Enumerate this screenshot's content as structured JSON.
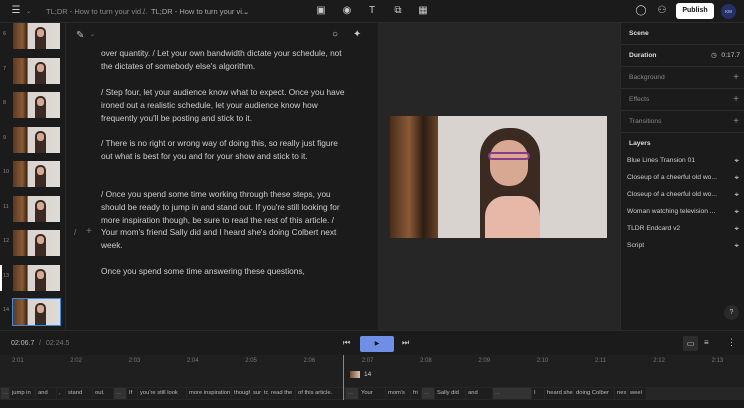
{
  "topbar": {
    "crumb1": "TL;DR - How to turn your vid...",
    "sep": "/",
    "crumb2": "TL;DR - How to turn your vi...",
    "publish": "Publish",
    "avatar": "KM"
  },
  "scenes": [
    {
      "n": "6"
    },
    {
      "n": "7"
    },
    {
      "n": "8"
    },
    {
      "n": "9"
    },
    {
      "n": "10"
    },
    {
      "n": "11"
    },
    {
      "n": "12"
    },
    {
      "n": "13"
    },
    {
      "n": "14"
    }
  ],
  "script": {
    "p1": "over quantity. / Let your own bandwidth dictate your schedule, not the dictates of somebody else's algorithm.",
    "p2": "/ Step four, let your audience know what to expect. Once you have ironed out a realistic schedule, let your audience know how frequently you'll be posting and stick to it.",
    "p3": "/ There is no right or wrong way of doing this, so really just figure out what is best for you and for your show and stick to it.",
    "p4": "/ Once you spend some time working through these steps, you should be ready to jump in and stand out. If you're still looking for more inspiration though, be sure to read the rest of this article. / Your mom's friend Sally did and I heard she's doing Colbert next week.",
    "p5": "Once you spend some time answering these questions,"
  },
  "panel": {
    "scene": "Scene",
    "duration_label": "Duration",
    "duration": "0:17.7",
    "background": "Background",
    "effects": "Effects",
    "transitions": "Transitions",
    "layers_title": "Layers",
    "layers": [
      "Blue Lines Transion 01",
      "Closeup of a cheerful old wo...",
      "Closeup of a cheerful old wo...",
      "Woman watching television ...",
      "TLDR Endcard v2",
      "Script"
    ],
    "help": "?"
  },
  "timeline": {
    "current": "02:06.7",
    "sep": "/",
    "total": "02:24.5",
    "ticks": [
      "2:01",
      "2:02",
      "2:03",
      "2:04",
      "2:05",
      "2:06",
      "2:07",
      "2:08",
      "2:09",
      "2:10",
      "2:11",
      "2:12",
      "2:13"
    ],
    "scene_label": "14",
    "captions": [
      "...",
      "jump in",
      "and",
      ",",
      "stand",
      "out.",
      "...",
      "If",
      "you're still look",
      "more inspiration",
      "though",
      "sur",
      "to",
      "read the",
      "of this article.",
      "...",
      "Your",
      "mom's",
      "fri",
      "...",
      "Sally did",
      "and",
      "...",
      "I",
      "heard she",
      "doing Colber",
      "nex",
      "weel"
    ]
  },
  "colors": {
    "accent": "#6f8ee6",
    "selection": "#3d8be0"
  }
}
